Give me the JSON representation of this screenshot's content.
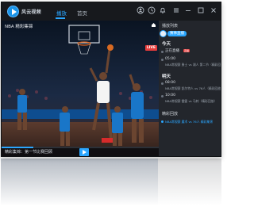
{
  "app": {
    "brand": "风云视频",
    "tabs": [
      {
        "label": "播放",
        "active": true
      },
      {
        "label": "首页",
        "active": false
      }
    ],
    "accent_color": "#2aa6ff",
    "window_controls": [
      "user-icon",
      "settings-icon",
      "notification-icon",
      "menu-icon",
      "minimize-icon",
      "maximize-icon",
      "close-icon"
    ]
  },
  "player": {
    "title": "NBA 精彩集锦",
    "live_badge": "LIVE",
    "caption": "精彩集锦：第一节比赛回顾",
    "progress": 0.2
  },
  "sidebar": {
    "header": "播放列表",
    "tag": "赛事直播",
    "days": [
      {
        "label": "今天",
        "items": [
          {
            "time": "",
            "text": "",
            "badge": "直播",
            "title": "正在直播"
          },
          {
            "time": "05:00",
            "text": "NBA常规赛 勇士 vs 湖人 第二节（精彩回放）",
            "active": false
          }
        ]
      },
      {
        "label": "明天",
        "items": [
          {
            "time": "08:00",
            "text": "NBA常规赛 凯尔特人 vs 76人（精彩回放）",
            "active": false
          },
          {
            "time": "10:00",
            "text": "NBA常规赛 雷霆 vs 马刺（精彩回放）",
            "active": false
          }
        ]
      }
    ],
    "section_label": "精彩回放",
    "highlight_item": {
      "time": "",
      "text": "NBA常规赛 魔术 vs 76人 精彩集锦",
      "active": true
    }
  }
}
